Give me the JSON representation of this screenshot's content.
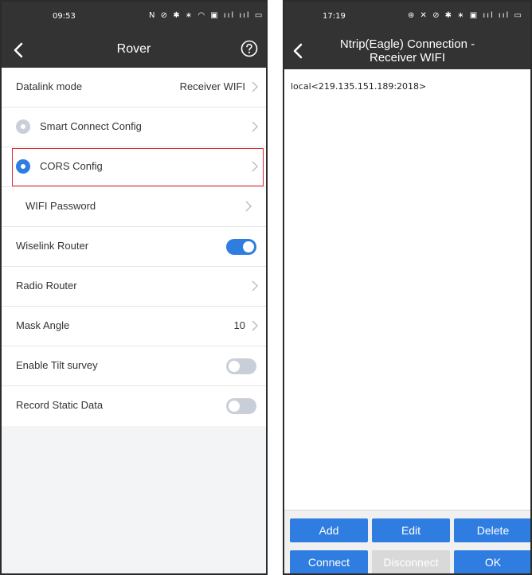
{
  "left": {
    "status": {
      "time": "09:53",
      "icons": "N ⊘ ✱ ∗ ◠ ▣ ııl ııl ▭"
    },
    "nav": {
      "title": "Rover"
    },
    "rows": {
      "datalink_label": "Datalink mode",
      "datalink_value": "Receiver WIFI",
      "smart_connect": "Smart Connect Config",
      "cors_config": "CORS Config",
      "wifi_password": "WIFI Password",
      "wiselink_router": "Wiselink Router",
      "radio_router": "Radio Router",
      "mask_angle_label": "Mask Angle",
      "mask_angle_value": "10",
      "tilt_survey": "Enable Tilt survey",
      "record_static": "Record Static Data"
    },
    "toggles": {
      "wiselink_router": true,
      "tilt_survey": false,
      "record_static": false
    },
    "radios": {
      "smart_connect": false,
      "cors_config": true
    }
  },
  "right": {
    "status": {
      "time": "17:19",
      "icons": "⊛ ✕ ⊘ ✱ ∗ ▣ ııl ııl ▭"
    },
    "nav": {
      "title_line1": "Ntrip(Eagle) Connection -",
      "title_line2": "Receiver WIFI"
    },
    "list": {
      "item": "local<219.135.151.189:2018>"
    },
    "buttons": {
      "add": "Add",
      "edit": "Edit",
      "delete": "Delete",
      "connect": "Connect",
      "disconnect": "Disconnect",
      "ok": "OK"
    }
  },
  "colors": {
    "accent": "#2f7de1",
    "header": "#333333",
    "highlight": "#e0262b"
  }
}
